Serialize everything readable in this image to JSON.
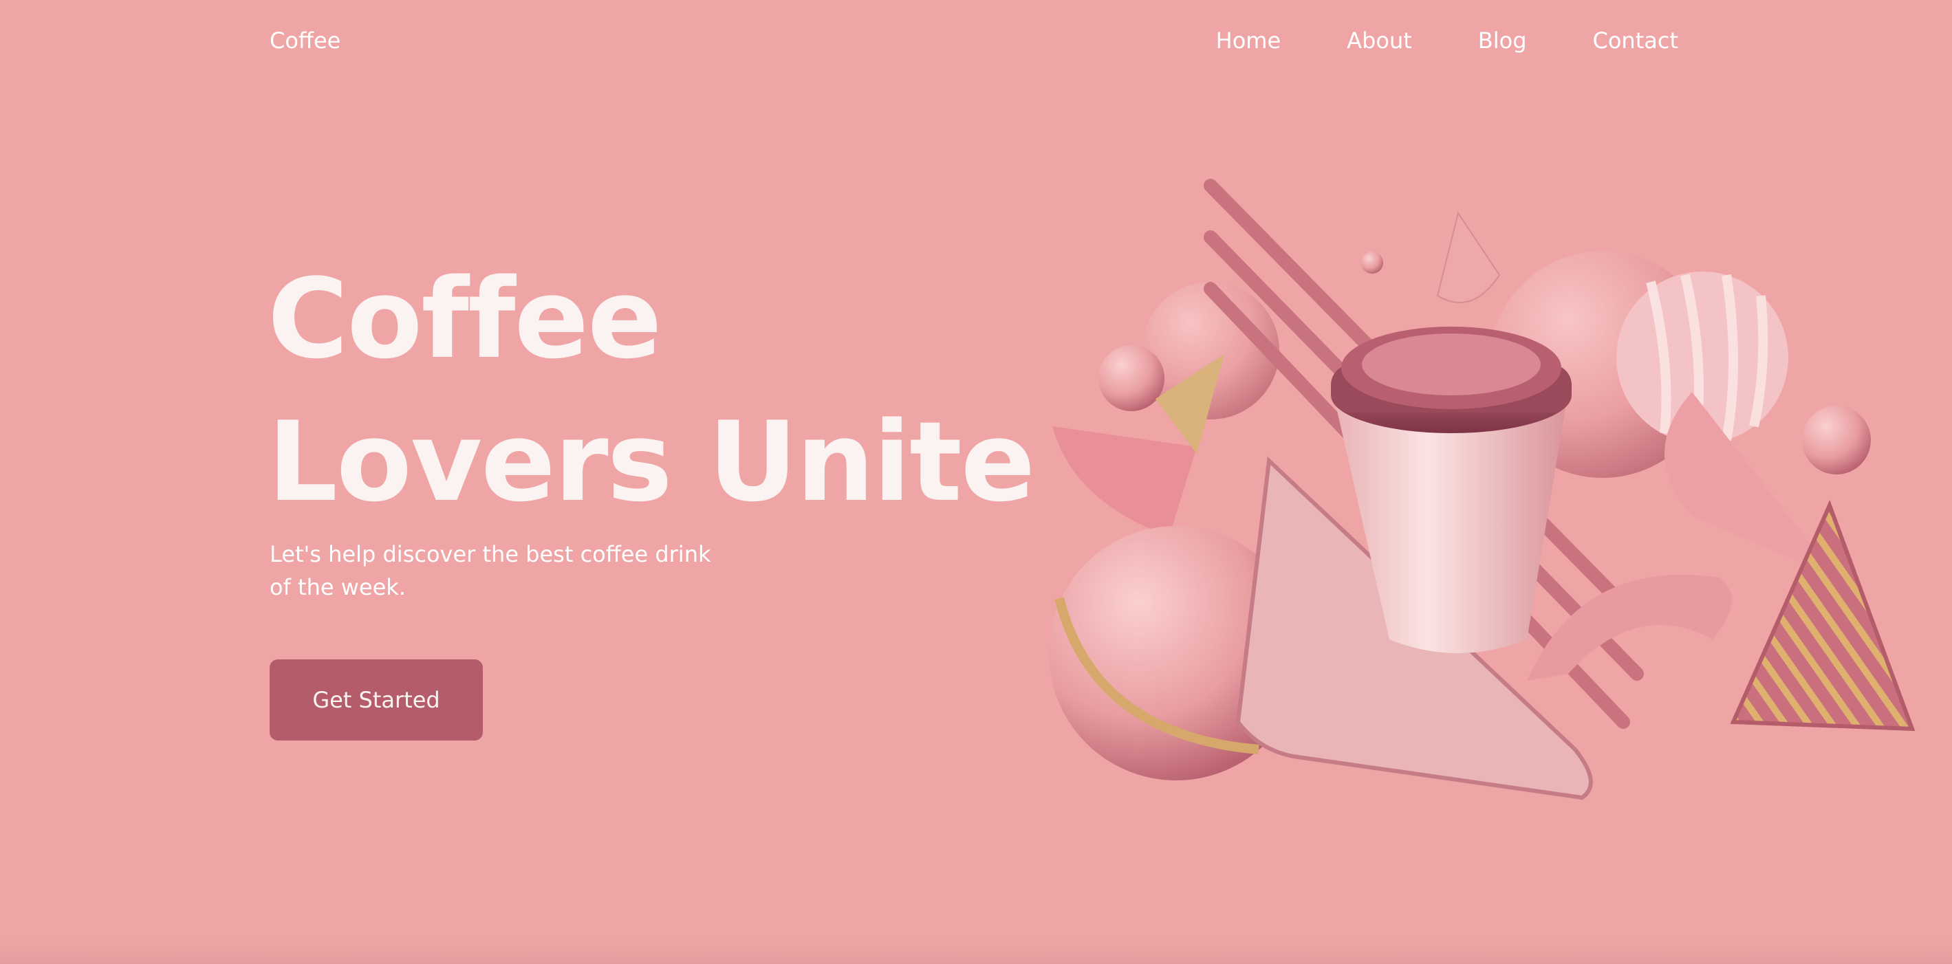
{
  "nav": {
    "logo": "Coffee",
    "links": [
      "Home",
      "About",
      "Blog",
      "Contact"
    ]
  },
  "hero": {
    "title_line1": "Coffee",
    "title_line2": "Lovers Unite",
    "subtitle_line1": "Let's help discover the best coffee drink",
    "subtitle_line2": "of the week.",
    "cta_label": "Get Started"
  },
  "colors": {
    "background": "#efa5a6",
    "button": "#b45c6a",
    "text": "#fbf3f1",
    "accent_gold": "#d8a86a"
  },
  "illustration": {
    "subject": "3d-coffee-cup-with-abstract-shapes"
  }
}
